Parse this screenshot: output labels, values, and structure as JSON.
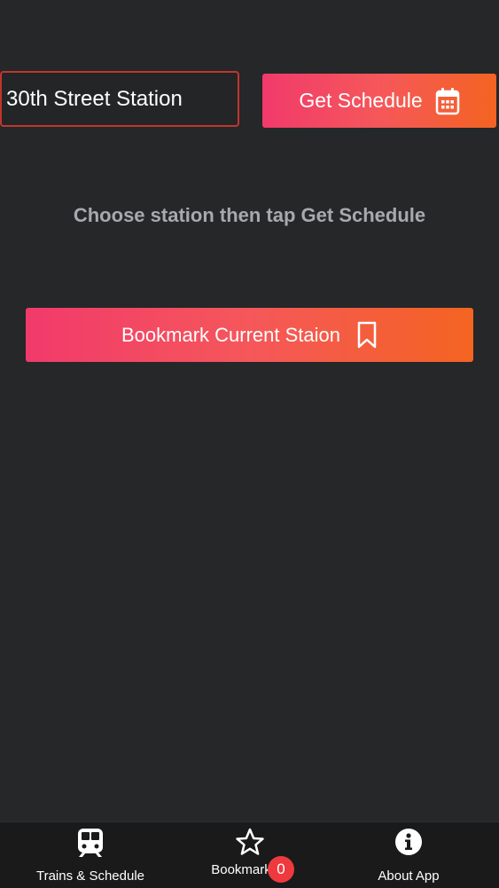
{
  "station_input": {
    "value": "30th Street Station"
  },
  "get_schedule": {
    "label": "Get Schedule",
    "icon": "calendar-icon"
  },
  "hint": {
    "text": "Choose station then tap Get Schedule"
  },
  "bookmark_button": {
    "label": "Bookmark Current Staion",
    "icon": "bookmark-icon"
  },
  "tabbar": {
    "items": [
      {
        "label": "Trains & Schedule",
        "icon": "train-icon"
      },
      {
        "label": "Bookmark",
        "icon": "star-icon",
        "badge": "0"
      },
      {
        "label": "About App",
        "icon": "info-icon"
      }
    ]
  },
  "colors": {
    "background": "#252729",
    "tabbar_background": "#1a1a1a",
    "gradient_start": "#f13a6b",
    "gradient_end": "#f46421",
    "input_border": "#c2352d",
    "hint_text": "#a7a9ac",
    "badge": "#ee3a3f"
  }
}
